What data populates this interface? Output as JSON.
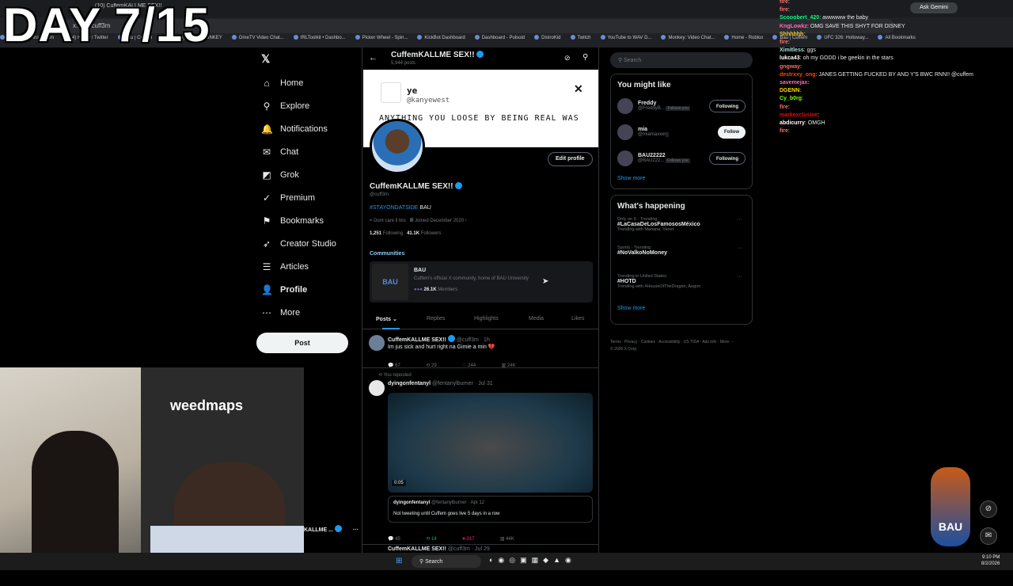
{
  "overlay": {
    "day_text": "DAY 7/15"
  },
  "browser": {
    "tabs": [
      "(10) CuffemKALLME SEX!!",
      "Kick",
      "Ask Gemini"
    ],
    "address": "x.com/cuff3m",
    "bookmarks": [
      "Kick",
      "Instagram",
      "(4) Home / Twitter",
      "Bau | Cuffem",
      "Monkey",
      "DONKEY",
      "OmeTV Video Chat...",
      "IRLToolkit • Dashbo...",
      "Picker Wheel - Spin...",
      "KickBot Dashboard",
      "Dashboard - Pulsoid",
      "DistroKid",
      "Twitch",
      "YouTube to WAV D...",
      "Monkey: Video Chat...",
      "Home - Roblox",
      "Bau | Cuffem",
      "UFC 326: Holloway...",
      "All Bookmarks"
    ],
    "ask_gemini": "Ask Gemini"
  },
  "nav": {
    "items": [
      {
        "label": "Home",
        "icon": "home-icon",
        "glyph": "⌂"
      },
      {
        "label": "Explore",
        "icon": "search-icon",
        "glyph": "⚲"
      },
      {
        "label": "Notifications",
        "icon": "bell-icon",
        "glyph": "🔔"
      },
      {
        "label": "Chat",
        "icon": "mail-icon",
        "glyph": "✉"
      },
      {
        "label": "Grok",
        "icon": "grok-icon",
        "glyph": "◩"
      },
      {
        "label": "Premium",
        "icon": "premium-icon",
        "glyph": "✓"
      },
      {
        "label": "Bookmarks",
        "icon": "bookmark-icon",
        "glyph": "⚑"
      },
      {
        "label": "Creator Studio",
        "icon": "rocket-icon",
        "glyph": "➶"
      },
      {
        "label": "Articles",
        "icon": "article-icon",
        "glyph": "☰"
      },
      {
        "label": "Profile",
        "icon": "person-icon",
        "glyph": "👤"
      },
      {
        "label": "More",
        "icon": "more-icon",
        "glyph": "⋯"
      }
    ],
    "post": "Post",
    "bottom_name": "KALLME ..."
  },
  "profile": {
    "header_name": "CuffemKALLME SEX!!",
    "header_posts": "5,944 posts",
    "banner_name": "ye",
    "banner_handle": "@kanyewest",
    "banner_text": "ANYTHING YOU LOOSE BY BEING REAL WAS",
    "edit": "Edit profile",
    "name": "CuffemKALLME SEX!!",
    "handle": "@cuff3m",
    "bio_tag": "#STAYONDATSIDE",
    "bio_rest": " BAU",
    "location": "Dont care ll bro",
    "joined": "Joined December 2020",
    "following_count": "1,251",
    "following_label": "Following",
    "followers_count": "41.1K",
    "followers_label": "Followers",
    "communities_title": "Communities",
    "community_name": "BAU",
    "community_desc": "Cuffem's official X community, home of BAU University",
    "community_members": "26.1K",
    "community_members_label": "Members",
    "tabs": [
      "Posts",
      "Replies",
      "Highlights",
      "Media",
      "Likes"
    ]
  },
  "posts": [
    {
      "name": "CuffemKALLME SEX!!",
      "handle": "@cuff3m · 1h",
      "text": "Im jus sick and hurt right na Gimie a min 💔",
      "replies": "67",
      "reposts": "29",
      "likes": "244",
      "views": "24K"
    },
    {
      "reposted": "You reposted",
      "name": "dyingonfentanyl",
      "handle": "@fentanylburner · Jul 31",
      "video_time": "0:05",
      "quote_name": "dyingonfentanyl",
      "quote_handle": "@fentanylburner · Apr 12",
      "quote_text": "Not tweeting until Cuffem goes live 5 days in a row",
      "replies": "45",
      "reposts": "14",
      "likes": "917",
      "views": "44K"
    },
    {
      "name": "CuffemKALLME SEX!!",
      "handle": "@cuff3m · Jul 29"
    }
  ],
  "right": {
    "search_placeholder": "Search",
    "might_like_title": "You might like",
    "users": [
      {
        "name": "Freddy",
        "handle": "@FreddyB...",
        "follows_you": "Follows you",
        "button": "Following"
      },
      {
        "name": "mia",
        "handle": "@miamaxxer",
        "follows_you": "",
        "button": "Follow"
      },
      {
        "name": "BAU22222",
        "handle": "@BAU222...",
        "follows_you": "Follows you",
        "button": "Following"
      }
    ],
    "show_more": "Show more",
    "happening_title": "What's happening",
    "trends": [
      {
        "context": "Only on X · Trending",
        "topic": "#LaCasaDeLosFamososMéxico",
        "sub": "Trending with Mariana, Yanet"
      },
      {
        "context": "Sports · Trending",
        "topic": "#NoValkoNoMoney",
        "sub": ""
      },
      {
        "context": "Trending in United States",
        "topic": "#HOTD",
        "sub": "Trending with #HouseOfTheDragon, Aegon"
      }
    ],
    "footer": "Terms · Privacy · Cookies · Accessibility · US TIDA · Ads info · More ··· © 2026 X Corp."
  },
  "chat": [
    {
      "user": "fire",
      "text": ":",
      "color": "#ff6b6b"
    },
    {
      "user": "fire",
      "text": ":",
      "color": "#ff6b6b"
    },
    {
      "user": "Scooobert_420",
      "text": ": awwwww the baby",
      "color": "#00ff7f"
    },
    {
      "user": "KngLowkz",
      "text": ": OMG SAVE THIS SHYT FOR DISNEY",
      "color": "#ff69b4"
    },
    {
      "user": "Shhhhhh",
      "text": ":",
      "color": "#f4d03f"
    },
    {
      "user": "fire",
      "text": ":",
      "color": "#ff6b6b"
    },
    {
      "user": "Ximitless",
      "text": ": ggs",
      "color": "#a3e4d7"
    },
    {
      "user": "lukca43",
      "text": ": oh my GODD i be geekin in the stars",
      "color": "#ffffff"
    },
    {
      "user": "gngway",
      "text": ":",
      "color": "#ff6b6b"
    },
    {
      "user": "destrxxy_ong",
      "text": ": JANES GETTING FUCKED BY AND Y'S BWC RNN!! @cuffem",
      "color": "#ff4500"
    },
    {
      "user": "savemejax",
      "text": ":",
      "color": "#ff69b4"
    },
    {
      "user": "DGENN",
      "text": ":",
      "color": "#ffd700"
    },
    {
      "user": "Cy_b0rg",
      "text": ":",
      "color": "#7fff00"
    },
    {
      "user": "fire",
      "text": ":",
      "color": "#ff6b6b"
    },
    {
      "user": "markexclusive",
      "text": ":",
      "color": "#ff0000"
    },
    {
      "user": "abdicurry",
      "text": ": OMGH",
      "color": "#ffffff"
    },
    {
      "user": "fire",
      "text": ":",
      "color": "#ff6b6b"
    }
  ],
  "taskbar": {
    "search": "Search",
    "time": "9:10 PM",
    "date": "8/2/2026"
  }
}
